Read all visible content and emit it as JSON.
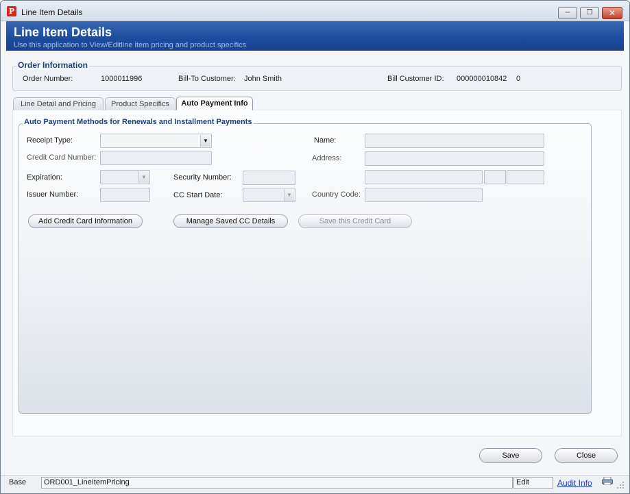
{
  "window": {
    "title": "Line Item Details",
    "app_icon_letter": "P"
  },
  "header": {
    "title": "Line Item Details",
    "subtitle": "Use this application to View/Editline item pricing and product specifics"
  },
  "order_info": {
    "legend": "Order Information",
    "order_number_label": "Order Number:",
    "order_number": "1000011996",
    "bill_to_label": "Bill-To Customer:",
    "bill_to": "John Smith",
    "bill_customer_id_label": "Bill Customer ID:",
    "bill_customer_id": "000000010842",
    "bill_customer_id_suffix": "0"
  },
  "tabs": [
    {
      "label": "Line Detail and Pricing",
      "active": false
    },
    {
      "label": "Product Specifics",
      "active": false
    },
    {
      "label": "Auto Payment Info",
      "active": true
    }
  ],
  "payment": {
    "legend": "Auto Payment Methods for Renewals and Installment Payments",
    "receipt_type_label": "Receipt Type:",
    "receipt_type_value": "",
    "credit_card_number_label": "Credit Card Number:",
    "expiration_label": "Expiration:",
    "security_number_label": "Security Number:",
    "issuer_number_label": "Issuer Number:",
    "cc_start_date_label": "CC Start Date:",
    "name_label": "Name:",
    "address_label": "Address:",
    "country_code_label": "Country Code:",
    "add_cc_button": "Add Credit Card Information",
    "manage_cc_button": "Manage Saved CC Details",
    "save_cc_button": "Save this Credit Card"
  },
  "footer": {
    "save_button": "Save",
    "close_button": "Close"
  },
  "statusbar": {
    "base": "Base",
    "form_name": "ORD001_LineItemPricing",
    "mode": "Edit",
    "audit_link": "Audit Info"
  },
  "icons": {
    "app": "app-logo-icon",
    "minimize": "minimize-icon",
    "restore": "restore-icon",
    "close": "close-icon",
    "dropdown": "chevron-down-icon",
    "printer": "printer-icon",
    "grip": "resize-grip-icon"
  },
  "colors": {
    "header_blue": "#1d4d9f",
    "legend_blue": "#1c3f7e",
    "link_blue": "#1f3fbf",
    "logo_red": "#d7261e"
  }
}
